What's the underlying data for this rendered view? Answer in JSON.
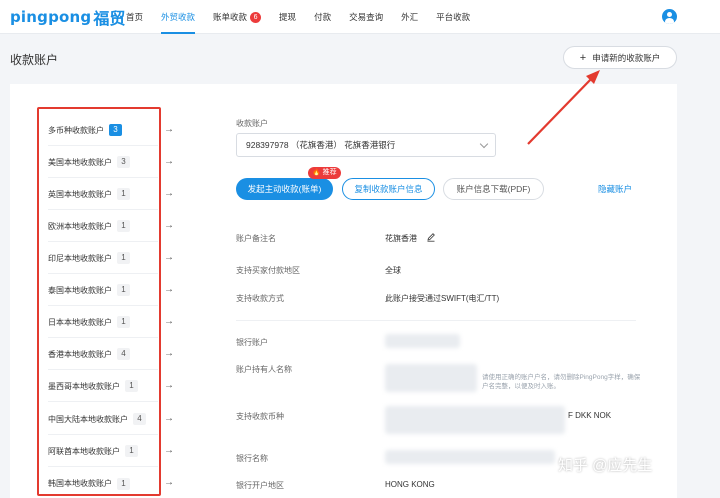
{
  "header": {
    "logo_en": "pingpong",
    "logo_cn": "福贸",
    "nav": [
      {
        "label": "首页",
        "active": false
      },
      {
        "label": "外贸收款",
        "active": true
      },
      {
        "label": "账单收款",
        "active": false,
        "badge": "6"
      },
      {
        "label": "提现",
        "active": false
      },
      {
        "label": "付款",
        "active": false
      },
      {
        "label": "交易查询",
        "active": false
      },
      {
        "label": "外汇",
        "active": false
      },
      {
        "label": "平台收款",
        "active": false
      }
    ]
  },
  "page": {
    "title": "收款账户",
    "new_account_button": "申请新的收款账户"
  },
  "accounts": [
    {
      "label": "多币种收款账户",
      "count": "3",
      "active": true
    },
    {
      "label": "美国本地收款账户",
      "count": "3"
    },
    {
      "label": "英国本地收款账户",
      "count": "1"
    },
    {
      "label": "欧洲本地收款账户",
      "count": "1"
    },
    {
      "label": "印尼本地收款账户",
      "count": "1"
    },
    {
      "label": "泰国本地收款账户",
      "count": "1"
    },
    {
      "label": "日本本地收款账户",
      "count": "1"
    },
    {
      "label": "香港本地收款账户",
      "count": "4"
    },
    {
      "label": "墨西哥本地收款账户",
      "count": "1"
    },
    {
      "label": "中国大陆本地收款账户",
      "count": "4"
    },
    {
      "label": "阿联酋本地收款账户",
      "count": "1"
    },
    {
      "label": "韩国本地收款账户",
      "count": "1"
    }
  ],
  "detail": {
    "select_label": "收款账户",
    "select_value": "928397978 （花旗香港） 花旗香港银行",
    "primary_button": "发起主动收款(账单)",
    "primary_badge": "推荐",
    "copy_button": "复制收款账户信息",
    "download_button": "账户信息下载(PDF)",
    "hide_link": "隐藏账户",
    "fields": [
      {
        "label": "账户备注名",
        "value": "花旗香港"
      },
      {
        "label": "支持买家付款地区",
        "value": "全球"
      },
      {
        "label": "支持收款方式",
        "value": "此账户接受通过SWIFT(电汇/TT)"
      },
      {
        "label": "银行账户",
        "value": ""
      },
      {
        "label": "账户持有人名称",
        "value": ""
      },
      {
        "label": "支持收款币种",
        "value": "F DKK NOK"
      },
      {
        "label": "银行名称",
        "value": ""
      },
      {
        "label": "银行开户地区",
        "value": "HONG KONG"
      }
    ],
    "hint": "请使用正确的账户户名，请勿删除PingPong字样，确保户名完整，以便及时入账。"
  },
  "watermark": "知乎 @应先生",
  "colors": {
    "brand": "#1a8fe3",
    "highlight": "#e33a2f",
    "badge": "#ec3b3b"
  }
}
